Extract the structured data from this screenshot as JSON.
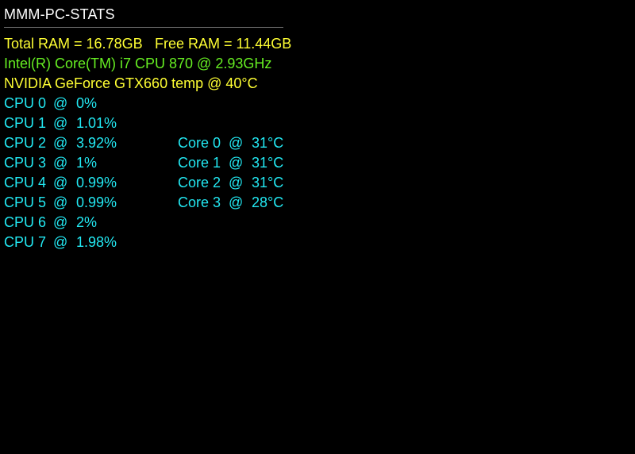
{
  "colors": {
    "header": "#ffffff",
    "yellow": "#ffff33",
    "green": "#66ee22",
    "cyan": "#22e8f2",
    "background": "#000000"
  },
  "module": {
    "title": "MMM-PC-STATS"
  },
  "ram": {
    "total": "Total RAM = 16.78GB",
    "free": "Free RAM = 11.44GB"
  },
  "cpu_info": "Intel(R) Core(TM) i7 CPU 870 @ 2.93GHz",
  "gpu_info": "NVIDIA GeForce GTX660 temp @ 40°C",
  "cpus": [
    {
      "name": "CPU 0",
      "at": "@",
      "value": "0%"
    },
    {
      "name": "CPU 1",
      "at": "@",
      "value": "1.01%"
    },
    {
      "name": "CPU 2",
      "at": "@",
      "value": "3.92%"
    },
    {
      "name": "CPU 3",
      "at": "@",
      "value": "1%"
    },
    {
      "name": "CPU 4",
      "at": "@",
      "value": "0.99%"
    },
    {
      "name": "CPU 5",
      "at": "@",
      "value": "0.99%"
    },
    {
      "name": "CPU 6",
      "at": "@",
      "value": "2%"
    },
    {
      "name": "CPU 7",
      "at": "@",
      "value": "1.98%"
    }
  ],
  "cores": [
    {
      "name": "Core 0",
      "at": "@",
      "value": "31°C"
    },
    {
      "name": "Core 1",
      "at": "@",
      "value": "31°C"
    },
    {
      "name": "Core 2",
      "at": "@",
      "value": "31°C"
    },
    {
      "name": "Core 3",
      "at": "@",
      "value": "28°C"
    }
  ]
}
